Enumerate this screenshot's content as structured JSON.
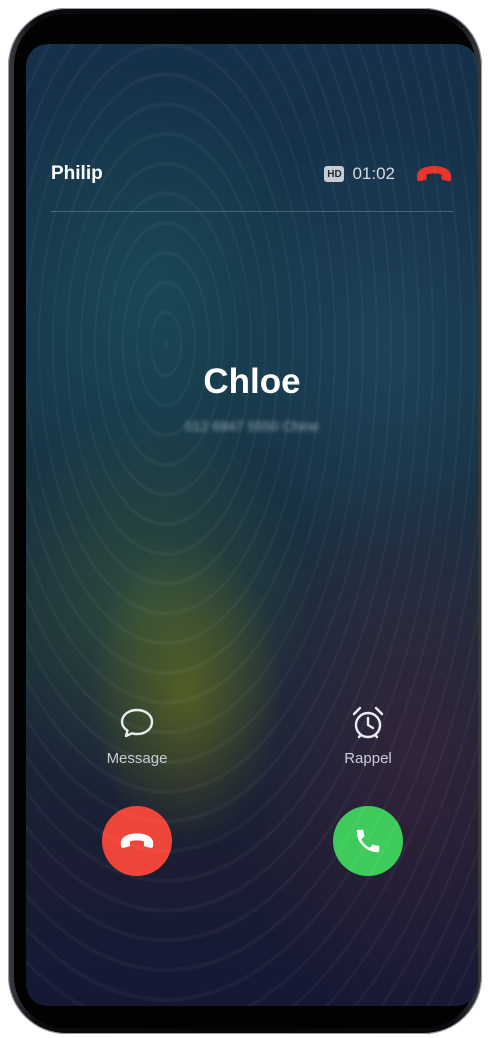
{
  "colors": {
    "decline": "#ef4438",
    "answer": "#3ecb5c",
    "hangup_icon": "#e8332b",
    "text_primary": "#ffffff",
    "text_secondary": "#c9cdd3"
  },
  "active_call": {
    "name": "Philip",
    "hd_badge": "HD",
    "duration": "01:02",
    "hangup_icon": "phone-hangup-icon"
  },
  "incoming_call": {
    "name": "Chloe",
    "number_line": "012 6847 5550 Chine"
  },
  "actions": [
    {
      "label": "Message",
      "icon": "message-bubble-icon"
    },
    {
      "label": "Rappel",
      "icon": "alarm-clock-icon"
    }
  ],
  "buttons": {
    "decline_icon": "phone-hangup-icon",
    "answer_icon": "phone-icon"
  }
}
